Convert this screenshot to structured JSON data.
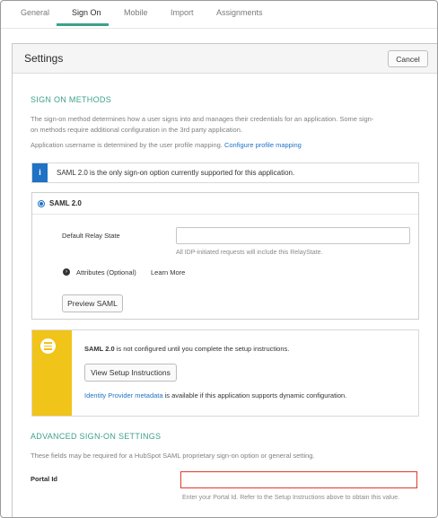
{
  "tabs": [
    {
      "label": "General"
    },
    {
      "label": "Sign On"
    },
    {
      "label": "Mobile"
    },
    {
      "label": "Import"
    },
    {
      "label": "Assignments"
    }
  ],
  "active_tab": "Sign On",
  "accent_color": "#3ea18a",
  "settings": {
    "title": "Settings",
    "cancel_label": "Cancel"
  },
  "sign_on_methods": {
    "heading": "SIGN ON METHODS",
    "description_line1": "The sign-on method determines how a user signs into and manages their credentials for an application. Some sign-",
    "description_line2": "on methods require additional configuration in the 3rd party application.",
    "username_note": "Application username is determined by the user profile mapping.",
    "configure_link": "Configure profile mapping",
    "info_text": "SAML 2.0 is the only sign-on option currently supported for this application."
  },
  "saml": {
    "option_label": "SAML 2.0",
    "relay_state_label": "Default Relay State",
    "relay_state_value": "",
    "relay_state_hint": "All IDP-initiated requests will include this RelayState.",
    "attributes_label": "Attributes (Optional)",
    "learn_more": "Learn More",
    "preview_button": "Preview SAML"
  },
  "notice": {
    "bold": "SAML 2.0",
    "rest": " is not configured until you complete the setup instructions.",
    "button": "View Setup Instructions",
    "metadata_link": "Identity Provider metadata",
    "metadata_rest": " is available if this application supports dynamic configuration."
  },
  "advanced": {
    "heading": "ADVANCED SIGN-ON SETTINGS",
    "description": "These fields may be required for a HubSpot SAML proprietary sign-on option or general setting.",
    "portal_label": "Portal Id",
    "portal_value": "",
    "portal_hint": "Enter your Portal Id. Refer to the Setup Instructions above to obtain this value."
  }
}
